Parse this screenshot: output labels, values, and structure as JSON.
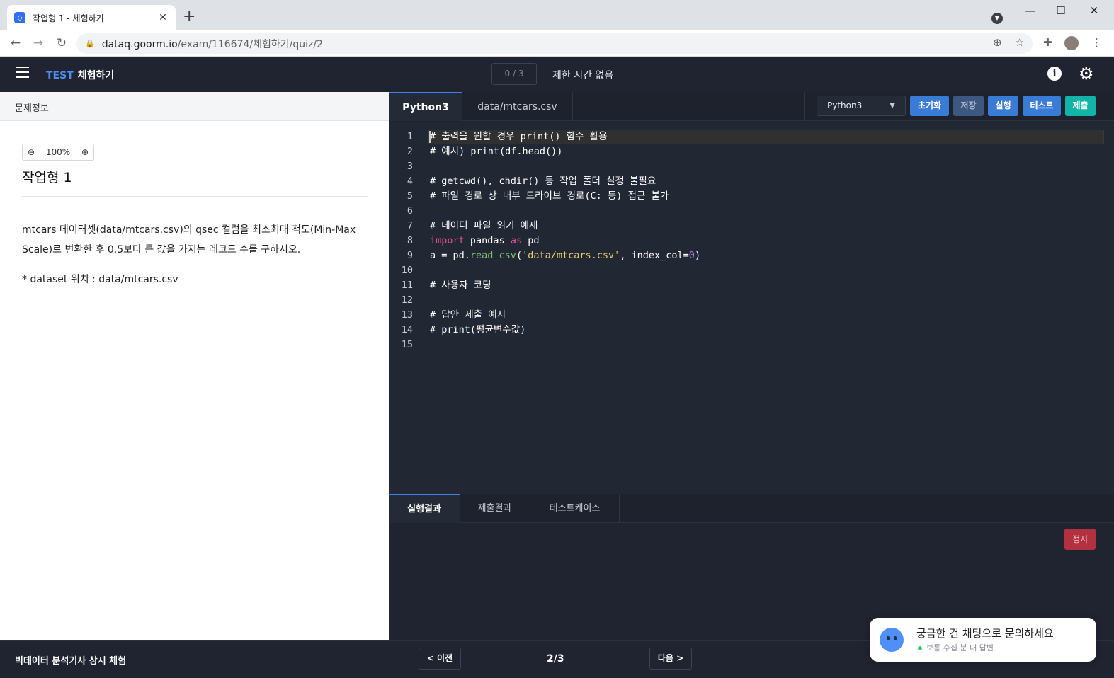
{
  "browser": {
    "tab_title": "작업형 1 - 체험하기",
    "url_host": "dataq.goorm.io",
    "url_path": "/exam/116674/체험하기/quiz/2"
  },
  "header": {
    "brand_prefix": "TEST",
    "brand_name": "체험하기",
    "progress": "0 / 3",
    "time_limit": "제한 시간 없음"
  },
  "left_panel": {
    "heading": "문제정보",
    "zoom_level": "100%",
    "question_title": "작업형 1",
    "question_body": "mtcars 데이터셋(data/mtcars.csv)의 qsec 컬럼을 최소최대 척도(Min-Max Scale)로 변환한 후 0.5보다 큰 값을 가지는 레코드 수를 구하시오.",
    "dataset_note": "* dataset 위치 : data/mtcars.csv"
  },
  "editor": {
    "tabs": [
      {
        "label": "Python3"
      },
      {
        "label": "data/mtcars.csv"
      }
    ],
    "language": "Python3",
    "buttons": {
      "reset": "초기화",
      "save": "저장",
      "run": "실행",
      "test": "테스트",
      "submit": "제출"
    },
    "colors": {
      "reset": "#3a7bd5",
      "save": "#3c5880",
      "run": "#3a7bd5",
      "test": "#3a7bd5",
      "submit": "#12b3a8"
    },
    "line_numbers": [
      "1",
      "2",
      "3",
      "4",
      "5",
      "6",
      "7",
      "8",
      "9",
      "10",
      "11",
      "12",
      "13",
      "14",
      "15"
    ],
    "code": {
      "l1": "# 출력을 원할 경우 print() 함수 활용",
      "l2": "# 예시) print(df.head())",
      "l4": "# getcwd(), chdir() 등 작업 폴더 설정 불필요",
      "l5": "# 파일 경로 상 내부 드라이브 경로(C: 등) 접근 불가",
      "l7": "# 데이터 파일 읽기 예제",
      "l8_kw1": "import",
      "l8_mod": " pandas ",
      "l8_kw2": "as",
      "l8_alias": " pd",
      "l9_pre": "a = pd.",
      "l9_fn": "read_csv",
      "l9_open": "(",
      "l9_str": "'data/mtcars.csv'",
      "l9_mid": ", index_col=",
      "l9_num": "0",
      "l9_close": ")",
      "l11": "# 사용자 코딩",
      "l13": "# 답안 제출 예시",
      "l14": "# print(평균변수값)"
    }
  },
  "output": {
    "tabs": [
      {
        "label": "실행결과"
      },
      {
        "label": "제출결과"
      },
      {
        "label": "테스트케이스"
      }
    ],
    "stop_label": "정지"
  },
  "footer": {
    "title": "빅데이터 분석기사 상시 체험",
    "prev_label": "< 이전",
    "page": "2/3",
    "next_label": "다음 >"
  },
  "chat": {
    "title": "궁금한 건 채팅으로 문의하세요",
    "status": "보통 수십 분 내 답변"
  }
}
